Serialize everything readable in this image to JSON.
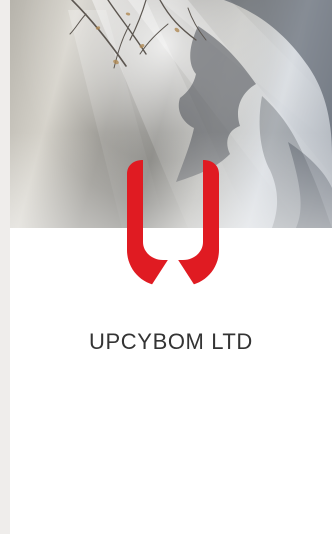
{
  "app": {
    "company_name": "UPCYBOM LTD"
  },
  "icons": {
    "logo": "u-shield-logo-icon"
  },
  "colors": {
    "brand_red": "#e01b22",
    "card_background": "#ffffff",
    "page_background": "#efedeb",
    "text": "#343434"
  }
}
